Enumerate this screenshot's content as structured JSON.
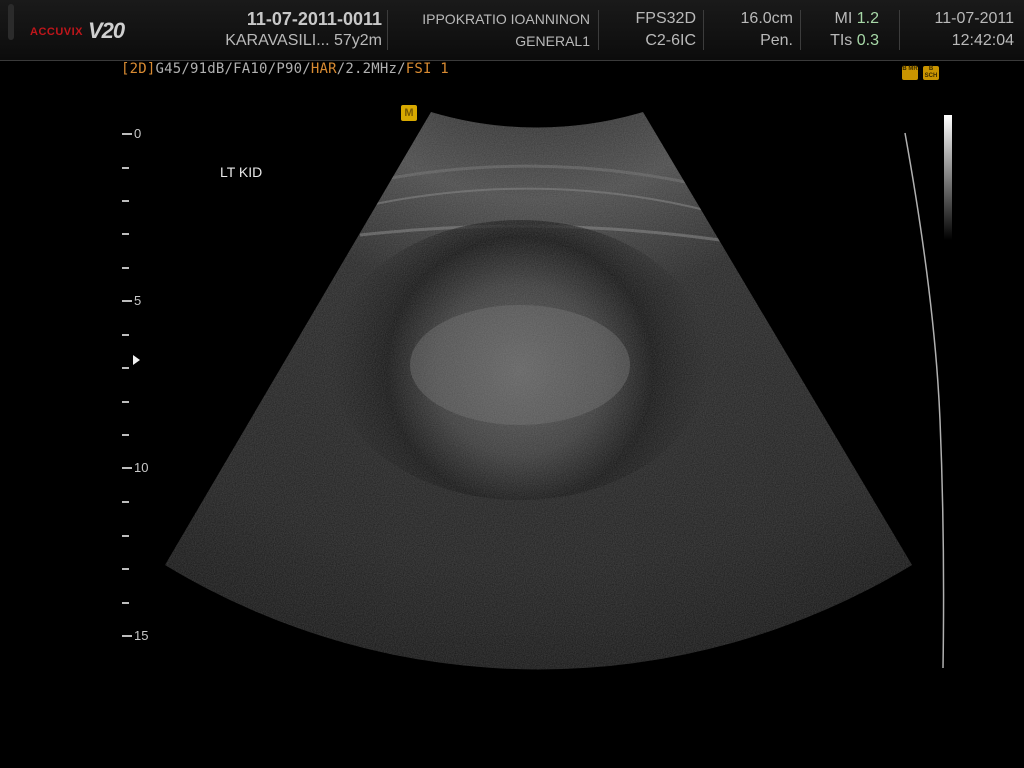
{
  "brand": {
    "accu": "ACCUVIX",
    "model": "V20"
  },
  "header": {
    "exam_id": "11-07-2011-0011",
    "patient": "KARAVASILI... 57y2m",
    "institution": "IPPOKRATIO IOANNINON",
    "preset": "GENERAL1",
    "fps": "FPS32D",
    "probe": "C2-6IC",
    "depth": "16.0cm",
    "mode": "Pen.",
    "mi_label": "MI",
    "mi_value": "1.2",
    "tis_label": "TIs",
    "tis_value": "0.3",
    "date": "11-07-2011",
    "time": "12:42:04"
  },
  "params": {
    "mode_tag": "[2D]",
    "values": "G45/91dB/FA10/P90/",
    "har": "HAR",
    "freq": "/2.2MHz/",
    "fsi": "FSI 1"
  },
  "badges": {
    "m": "M",
    "r1": "B MR",
    "r2": "B SCH"
  },
  "annotation": "LT KID",
  "depth_scale": {
    "labels": [
      "0",
      "5",
      "10",
      "15"
    ]
  },
  "colors": {
    "background": "#000000",
    "accent": "#d98b32",
    "badge": "#c99400",
    "value_green": "#a7d8a7",
    "brand_red": "#c0161b"
  }
}
